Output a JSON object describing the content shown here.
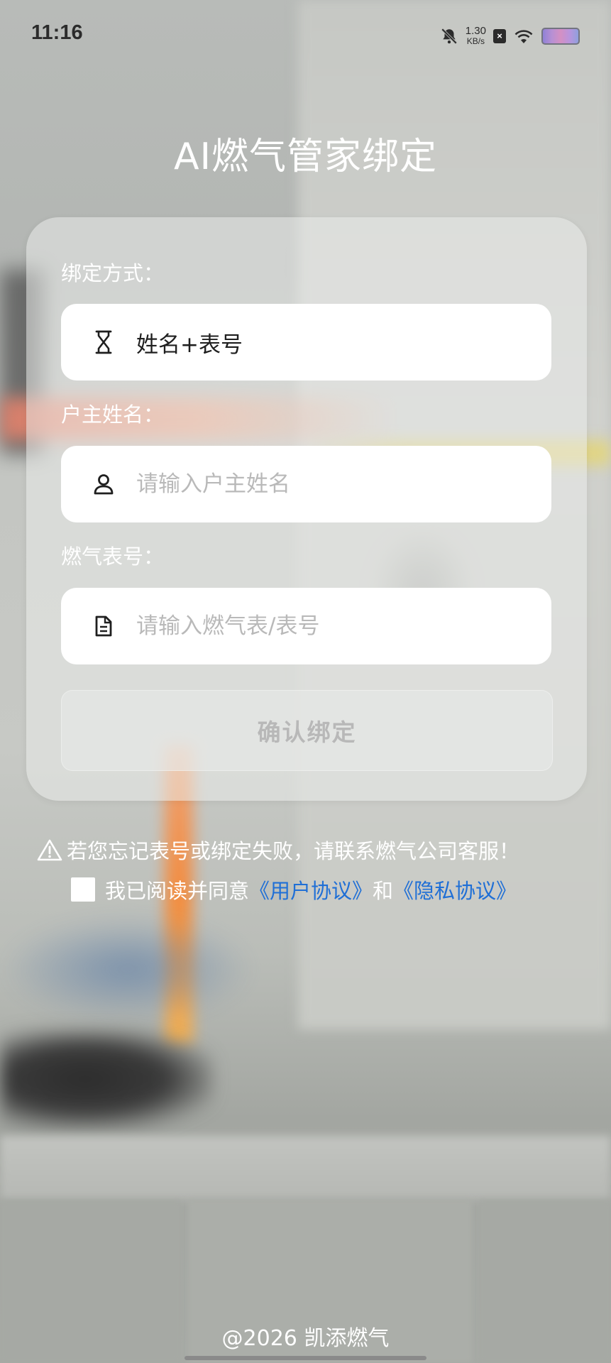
{
  "status_bar": {
    "time": "11:16",
    "net_speed_value": "1.30",
    "net_speed_unit": "KB/s",
    "sim_glyph": "×"
  },
  "title": "AI燃气管家绑定",
  "form": {
    "bind_method": {
      "label": "绑定方式：",
      "value": "姓名+表号",
      "icon": "hourglass-icon"
    },
    "owner_name": {
      "label": "户主姓名：",
      "placeholder": "请输入户主姓名",
      "value": "",
      "icon": "user-icon"
    },
    "meter_number": {
      "label": "燃气表号：",
      "placeholder": "请输入燃气表/表号",
      "value": "",
      "icon": "document-icon"
    },
    "confirm_label": "确认绑定"
  },
  "notice": "若您忘记表号或绑定失败，请联系燃气公司客服！",
  "agreement": {
    "checked": false,
    "prefix": "我已阅读并同意",
    "user_agreement": "《用户协议》",
    "conjunction": "和",
    "privacy_policy": "《隐私协议》"
  },
  "footer": "@2026 凯添燃气",
  "colors": {
    "link": "#1f6fd6",
    "text_on_bg": "#ffffff",
    "placeholder": "#b9b9b9",
    "button_disabled_text": "#b8b8b8"
  }
}
